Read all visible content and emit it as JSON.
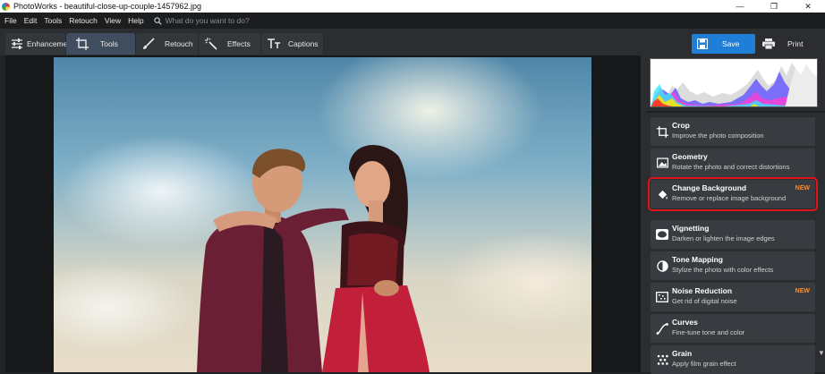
{
  "window": {
    "title": "PhotoWorks - beautiful-close-up-couple-1457962.jpg",
    "controls": [
      "—",
      "❐",
      "✕"
    ]
  },
  "menu": {
    "items": [
      "File",
      "Edit",
      "Tools",
      "Retouch",
      "View",
      "Help"
    ],
    "search_placeholder": "What do you want to do?"
  },
  "tabs": [
    {
      "label": "Enhancement",
      "icon": "sliders-icon"
    },
    {
      "label": "Tools",
      "icon": "crop-icon",
      "active": true
    },
    {
      "label": "Retouch",
      "icon": "brush-icon"
    },
    {
      "label": "Effects",
      "icon": "magic-wand-icon"
    },
    {
      "label": "Captions",
      "icon": "text-icon"
    }
  ],
  "actions": {
    "save_label": "Save",
    "print_label": "Print"
  },
  "tools": [
    {
      "name": "Crop",
      "desc": "Improve the photo composition",
      "icon": "crop-icon",
      "badge": ""
    },
    {
      "name": "Geometry",
      "desc": "Rotate the photo and correct distortions",
      "icon": "geometry-icon",
      "badge": ""
    },
    {
      "name": "Change Background",
      "desc": "Remove or replace image background",
      "icon": "paint-bucket-icon",
      "badge": "NEW",
      "highlighted": true
    },
    {
      "name": "Vignetting",
      "desc": "Darken or lighten the image edges",
      "icon": "vignette-icon",
      "badge": ""
    },
    {
      "name": "Tone Mapping",
      "desc": "Stylize the photo with color effects",
      "icon": "tone-icon",
      "badge": ""
    },
    {
      "name": "Noise Reduction",
      "desc": "Get rid of digital noise",
      "icon": "noise-icon",
      "badge": "NEW"
    },
    {
      "name": "Curves",
      "desc": "Fine-tune tone and color",
      "icon": "curves-icon",
      "badge": ""
    },
    {
      "name": "Grain",
      "desc": "Apply film grain effect",
      "icon": "grain-icon",
      "badge": ""
    }
  ],
  "colors": {
    "accent": "#1f7ed6",
    "badge": "#ff8a2a",
    "highlight_outline": "#e0121c",
    "panel": "#2b2d30",
    "item": "#383b3f"
  }
}
